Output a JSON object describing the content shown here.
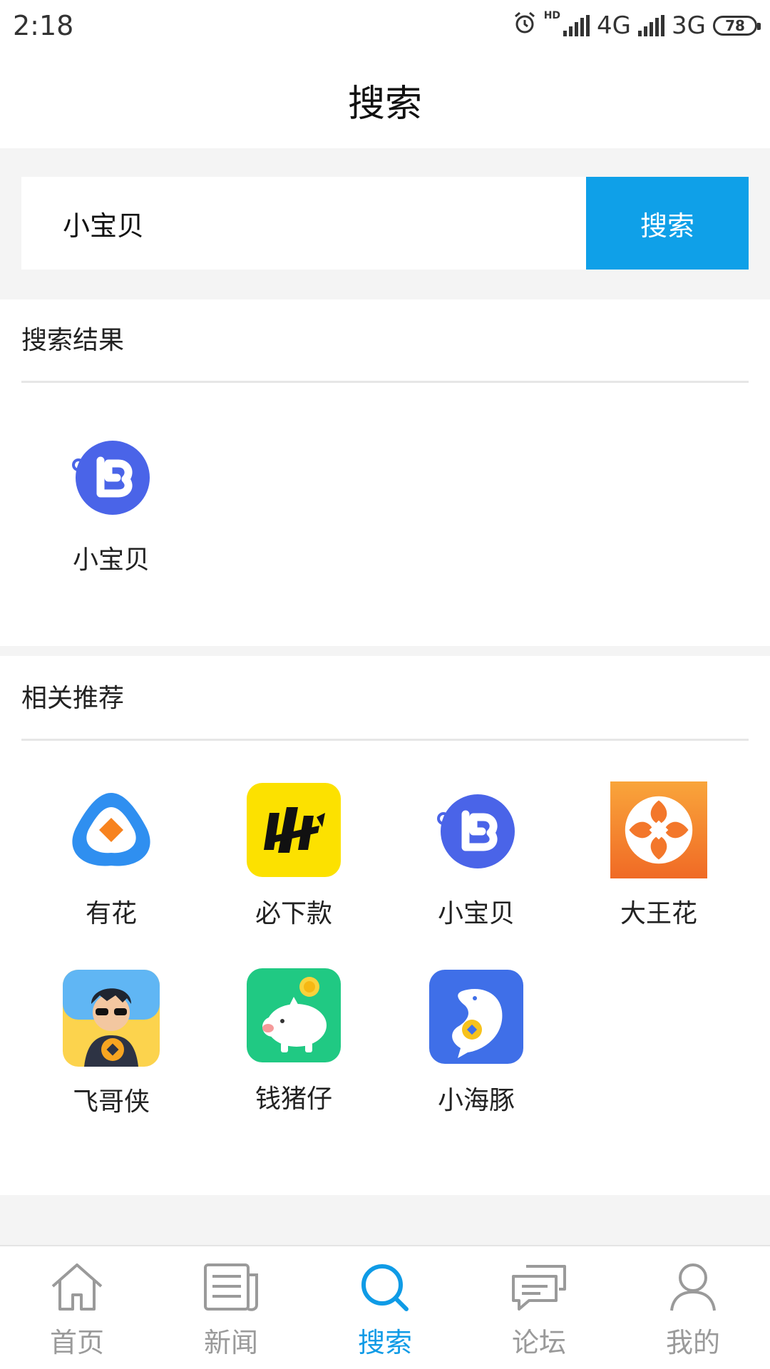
{
  "status_bar": {
    "time": "2:18",
    "network1": "4G",
    "network2": "3G",
    "battery": "78"
  },
  "header": {
    "title": "搜索"
  },
  "search": {
    "query": "小宝贝",
    "button_label": "搜索"
  },
  "results": {
    "title": "搜索结果",
    "items": [
      {
        "label": "小宝贝",
        "icon": "xiaobaobei-icon"
      }
    ]
  },
  "recommend": {
    "title": "相关推荐",
    "items": [
      {
        "label": "有花",
        "icon": "youhua-icon"
      },
      {
        "label": "必下款",
        "icon": "bixiakuan-icon"
      },
      {
        "label": "小宝贝",
        "icon": "xiaobaobei-icon"
      },
      {
        "label": "大王花",
        "icon": "dawanghua-icon"
      },
      {
        "label": "飞哥侠",
        "icon": "feigexia-icon"
      },
      {
        "label": "钱猪仔",
        "icon": "qianzhuzai-icon"
      },
      {
        "label": "小海豚",
        "icon": "xiaohaitun-icon"
      }
    ]
  },
  "tabs": [
    {
      "label": "首页",
      "icon": "home-icon"
    },
    {
      "label": "新闻",
      "icon": "news-icon"
    },
    {
      "label": "搜索",
      "icon": "search-icon",
      "active": true
    },
    {
      "label": "论坛",
      "icon": "forum-icon"
    },
    {
      "label": "我的",
      "icon": "profile-icon"
    }
  ],
  "colors": {
    "accent": "#0fa0e8",
    "tab_inactive": "#9a9a9a",
    "section_bg": "#f4f4f4"
  }
}
